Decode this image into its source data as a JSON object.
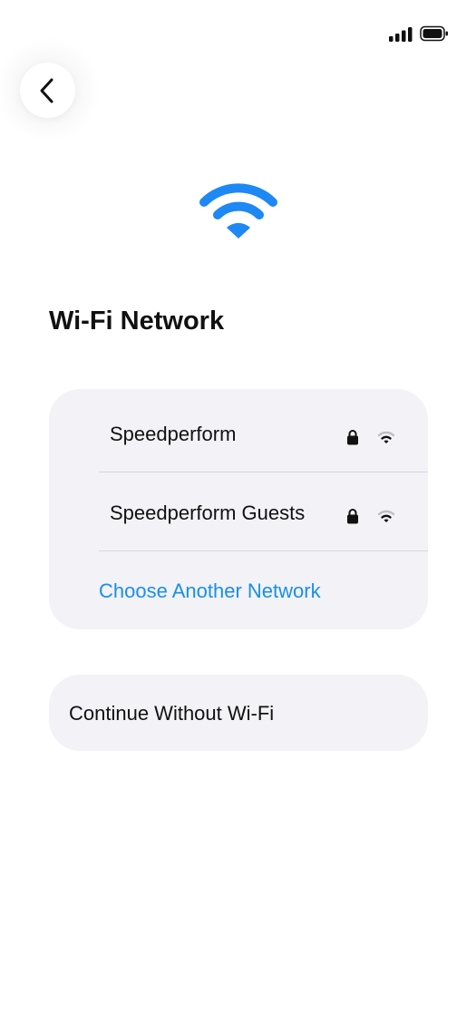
{
  "status_bar": {
    "signal_icon": "cellular-signal-icon",
    "battery_icon": "battery-icon"
  },
  "back_button": {
    "icon": "chevron-left-icon"
  },
  "hero": {
    "icon": "wifi-icon",
    "color": "#1E88F5"
  },
  "title": "Wi-Fi Network",
  "networks": [
    {
      "name": "Speedperform",
      "secured": true,
      "lock_icon": "lock-icon",
      "signal_icon": "wifi-signal-icon"
    },
    {
      "name": "Speedperform Guests",
      "secured": true,
      "lock_icon": "lock-icon",
      "signal_icon": "wifi-signal-icon"
    }
  ],
  "choose_another": {
    "label": "Choose Another Network",
    "color": "#1A8FE8"
  },
  "continue_without": {
    "label": "Continue Without Wi-Fi"
  }
}
